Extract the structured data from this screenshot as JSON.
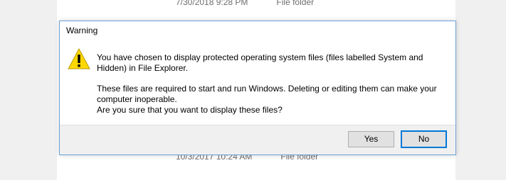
{
  "background": {
    "row_top": {
      "date": "7/30/2018 9:28 PM",
      "type": "File folder"
    },
    "row_bottom": {
      "date": "10/3/2017 10:24 AM",
      "type": "File folder"
    }
  },
  "dialog": {
    "title": "Warning",
    "icon": "warning-icon",
    "message_line1": "You have chosen to display protected operating system files (files labelled System and Hidden) in File Explorer.",
    "message_line2": "These files are required to start and run Windows. Deleting or editing them can make your computer inoperable.",
    "message_line3": "Are you sure that you want to display these files?",
    "buttons": {
      "yes": "Yes",
      "no": "No"
    }
  },
  "colors": {
    "accent": "#0078d7",
    "warning_yellow": "#ffd700",
    "dialog_border": "#6aa3d6"
  }
}
